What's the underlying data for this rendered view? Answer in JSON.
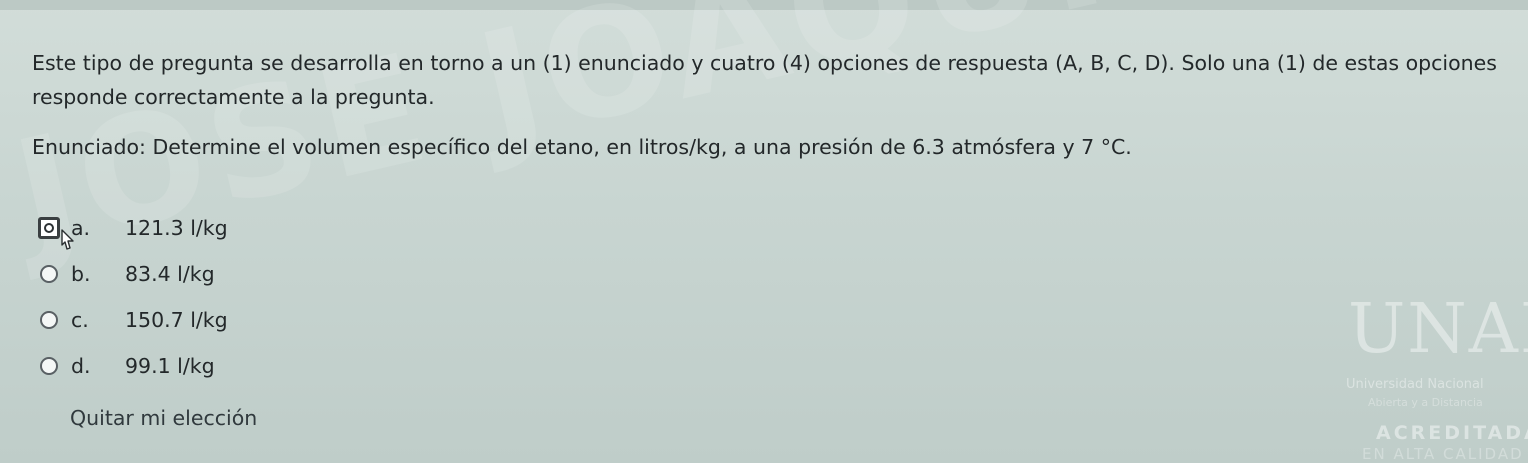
{
  "question": {
    "intro": "Este tipo de pregunta se desarrolla en torno a un (1) enunciado y cuatro (4) opciones de respuesta (A, B, C, D). Solo una (1) de estas opciones responde correctamente a la pregunta.",
    "stem": "Enunciado: Determine el volumen específico del etano, en litros/kg, a una presión de 6.3 atmósfera y 7 °C."
  },
  "options": [
    {
      "letter": "a.",
      "text": "121.3 l/kg",
      "selected": true
    },
    {
      "letter": "b.",
      "text": "83.4 l/kg",
      "selected": false
    },
    {
      "letter": "c.",
      "text": "150.7 l/kg",
      "selected": false
    },
    {
      "letter": "d.",
      "text": "99.1 l/kg",
      "selected": false
    }
  ],
  "clear_choice_label": "Quitar mi elección",
  "watermark": {
    "text": "JOSE JOAQUIN POLO PEREZ"
  },
  "logo": {
    "name": "UNAD",
    "subtitle": "Universidad Nacional",
    "subtitle2": "Abierta y a Distancia",
    "accreditation": "ACREDITADA",
    "accreditation2": "EN ALTA CALIDAD"
  },
  "colors": {
    "background": "#c9d6d2",
    "text": "#23282a"
  }
}
